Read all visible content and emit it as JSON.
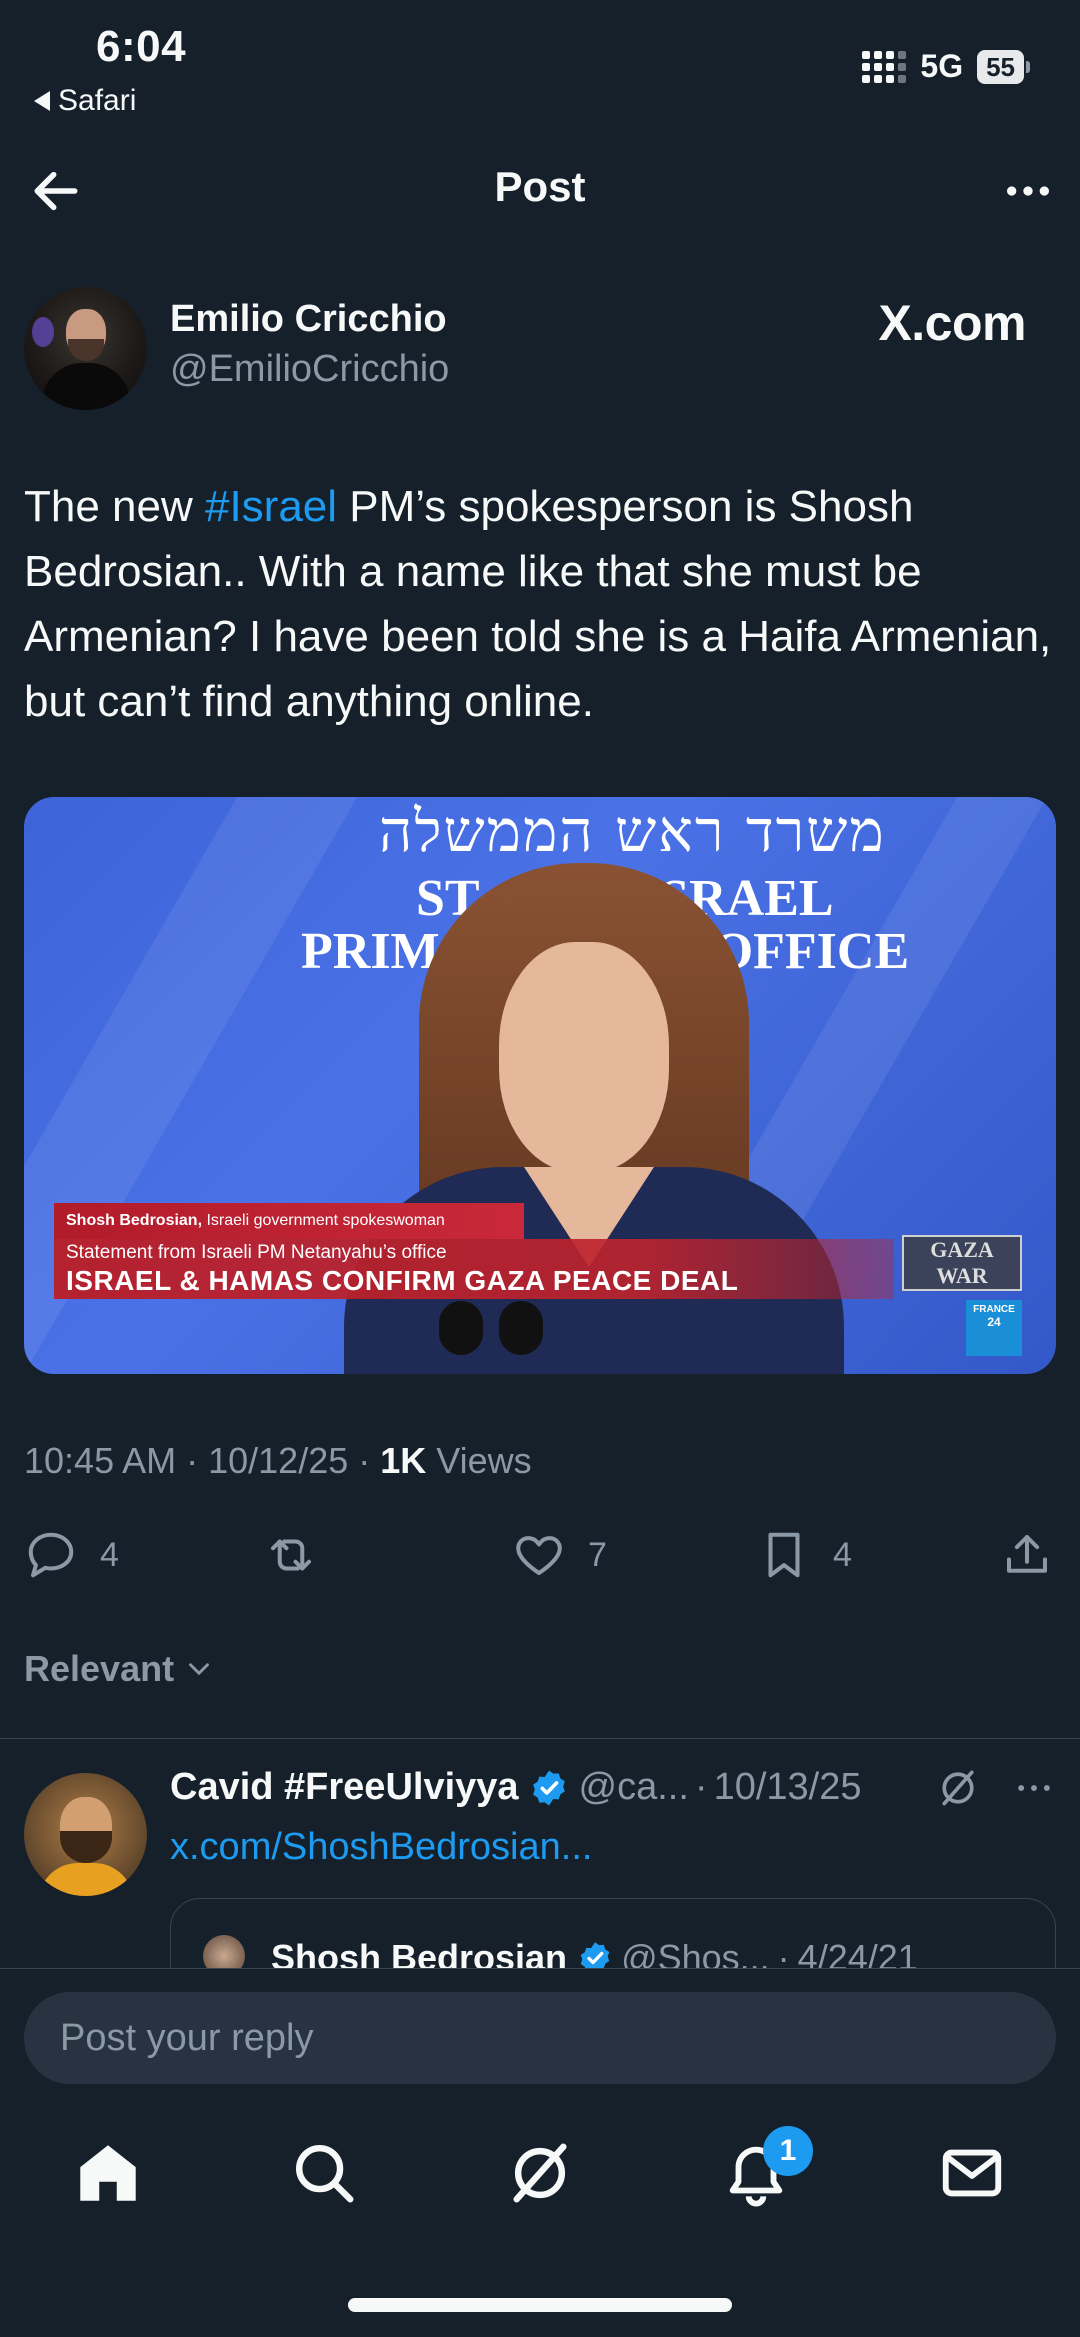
{
  "status_bar": {
    "time": "6:04",
    "back_app": "Safari",
    "network": "5G",
    "battery": "55"
  },
  "header": {
    "title": "Post"
  },
  "post": {
    "author_name": "Emilio Cricchio",
    "author_handle": "@EmilioCricchio",
    "source_label": "X.com",
    "text_before": "The new ",
    "hashtag": "#Israel",
    "text_after": " PM’s spokesperson is Shosh Bedrosian.. With a name like that she must be Armenian? I have been told she is a Haifa Armenian, but can’t find anything online.",
    "media": {
      "hebrew_title": "משרד ראש הממשלה",
      "line1": "ST      OF ISRAEL",
      "line2": "PRIM      STER’S OFFICE",
      "chyron_name": "Shosh Bedrosian,",
      "chyron_role": "Israeli government spokeswoman",
      "chyron_sub": "Statement from Israeli PM Netanyahu’s office",
      "chyron_main": "ISRAEL & HAMAS CONFIRM GAZA PEACE DEAL",
      "tag_line1": "GAZA",
      "tag_line2": "WAR",
      "logo_line1": "FRANCE",
      "logo_line2": "24"
    },
    "time": "10:45 AM",
    "date": "10/12/25",
    "views_count": "1K",
    "views_label": "Views",
    "actions": {
      "replies": "4",
      "likes": "7",
      "bookmarks": "4"
    }
  },
  "sort_label": "Relevant",
  "reply": {
    "name": "Cavid #FreeUlviyya",
    "handle": "@ca...",
    "date": "10/13/25",
    "link": "x.com/ShoshBedrosian...",
    "quote": {
      "name": "Shosh Bedrosian",
      "handle": "@Shos...",
      "date": "4/24/21"
    }
  },
  "composer": {
    "placeholder": "Post your reply"
  },
  "notifications_badge": "1",
  "colors": {
    "background": "#15202b",
    "accent": "#1d9bf0",
    "muted": "#8b98a5"
  }
}
